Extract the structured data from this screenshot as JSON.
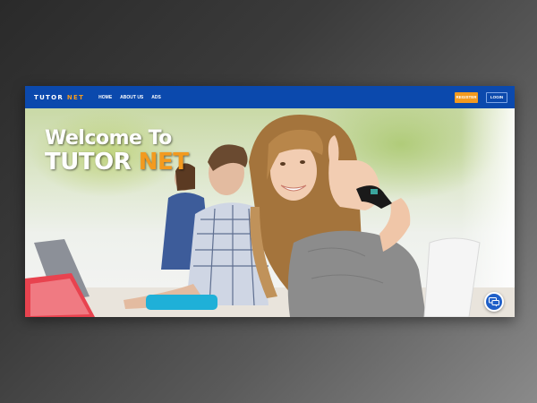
{
  "navbar": {
    "brand_part1": "TUTOR",
    "brand_part2": "NET",
    "links": [
      "HOME",
      "ABOUT US",
      "ADS"
    ],
    "register_label": "REGISTER",
    "login_label": "LOGIN"
  },
  "hero": {
    "title_line1": "Welcome To",
    "title_word1": "TUTOR",
    "title_word2": "NET"
  },
  "colors": {
    "navbar_bg": "#0b49ad",
    "accent_orange": "#f39a1f",
    "chat_button": "#1f5fc8"
  },
  "icons": {
    "chat": "chat-bubble-icon"
  }
}
